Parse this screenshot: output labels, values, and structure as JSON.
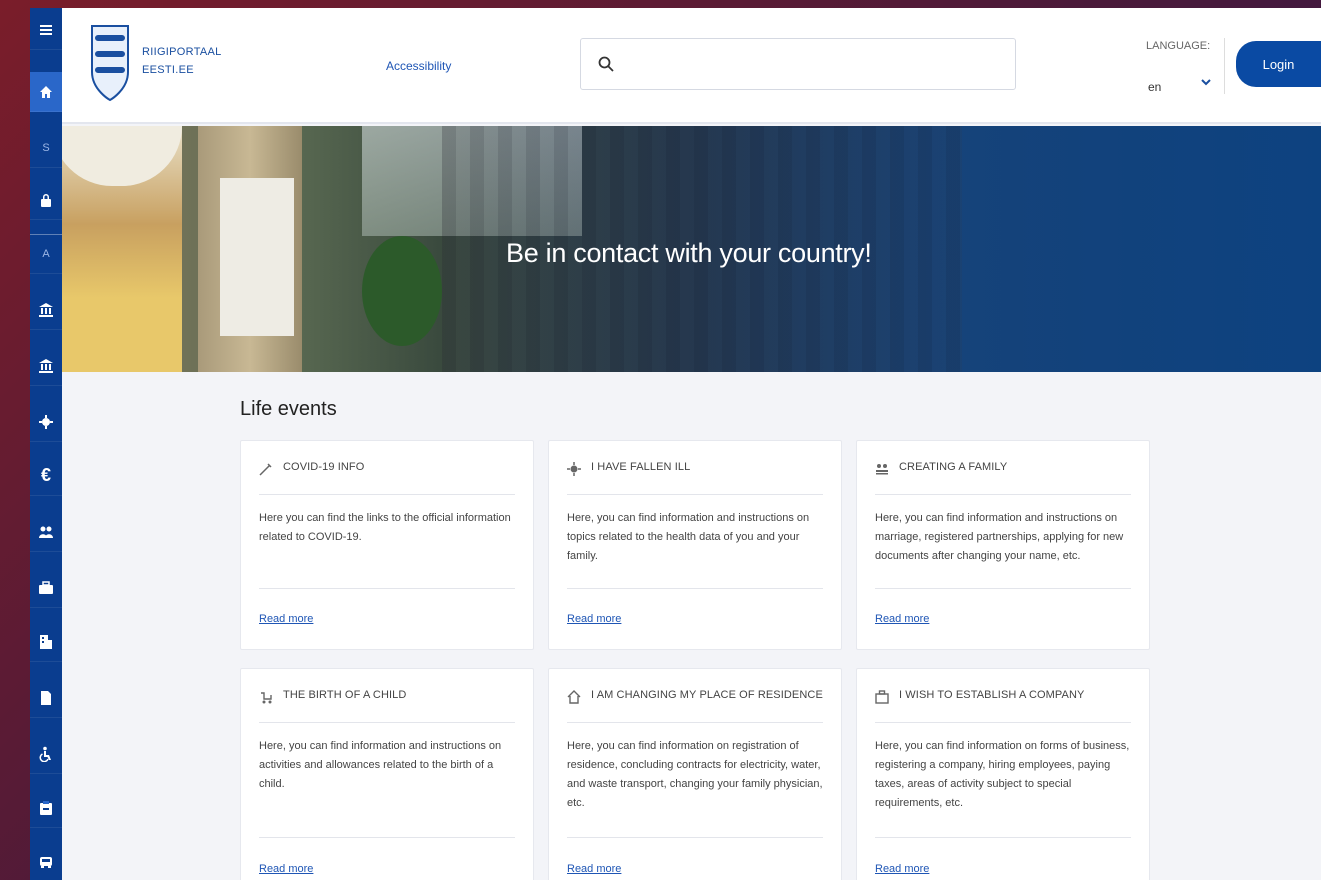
{
  "rail": {
    "items": [
      {
        "icon": "menu-icon",
        "glyph": "≡"
      },
      {
        "icon": "home-icon",
        "glyph": "⌂"
      },
      {
        "icon": "letter-s",
        "glyph": "S"
      },
      {
        "icon": "lock-icon",
        "glyph": "🔒"
      },
      {
        "icon": "letter-a",
        "glyph": "A"
      },
      {
        "icon": "bank-icon",
        "glyph": "🏛"
      },
      {
        "icon": "bank-icon-2",
        "glyph": "🏛"
      },
      {
        "icon": "virus-icon",
        "glyph": "✲"
      },
      {
        "icon": "euro-icon",
        "glyph": "€"
      },
      {
        "icon": "people-icon",
        "glyph": "👥"
      },
      {
        "icon": "briefcase-icon",
        "glyph": "💼"
      },
      {
        "icon": "building-icon",
        "glyph": "🏢"
      },
      {
        "icon": "document-icon",
        "glyph": "📄"
      },
      {
        "icon": "accessibility-icon",
        "glyph": "♿"
      },
      {
        "icon": "clipboard-icon",
        "glyph": "📋"
      },
      {
        "icon": "car-icon",
        "glyph": "🚗"
      }
    ]
  },
  "header": {
    "brand_line1": "RIIGIPORTAAL",
    "brand_line2": "EESTI.EE",
    "accessibility": "Accessibility",
    "search_placeholder": "",
    "language_label": "LANGUAGE:",
    "language_value": "en",
    "login": "Login"
  },
  "hero": {
    "title": "Be in contact with your country!"
  },
  "main": {
    "section_title": "Life events",
    "cards": [
      {
        "icon": "syringe-icon",
        "title": "COVID-19 INFO",
        "description": "Here you can find the links to the official information related to COVID-19.",
        "link": "Read more"
      },
      {
        "icon": "virus-icon",
        "title": "I HAVE FALLEN ILL",
        "description": "Here, you can find information and instructions on topics related to the health data of you and your family.",
        "link": "Read more"
      },
      {
        "icon": "family-icon",
        "title": "CREATING A FAMILY",
        "description": "Here, you can find information and instructions on marriage, registered partnerships, applying for new documents after changing your name, etc.",
        "link": "Read more"
      },
      {
        "icon": "stroller-icon",
        "title": "THE BIRTH OF A CHILD",
        "description": "Here, you can find information and instructions on activities and allowances related to the birth of a child.",
        "link": "Read more"
      },
      {
        "icon": "house-icon",
        "title": "I AM CHANGING MY PLACE OF RESIDENCE",
        "description": "Here, you can find information on registration of residence, concluding contracts for electricity, water, and waste transport, changing your family physician, etc.",
        "link": "Read more"
      },
      {
        "icon": "briefcase-icon",
        "title": "I WISH TO ESTABLISH A COMPANY",
        "description": "Here, you can find information on forms of business, registering a company, hiring employees, paying taxes, areas of activity subject to special requirements, etc.",
        "link": "Read more"
      }
    ]
  }
}
